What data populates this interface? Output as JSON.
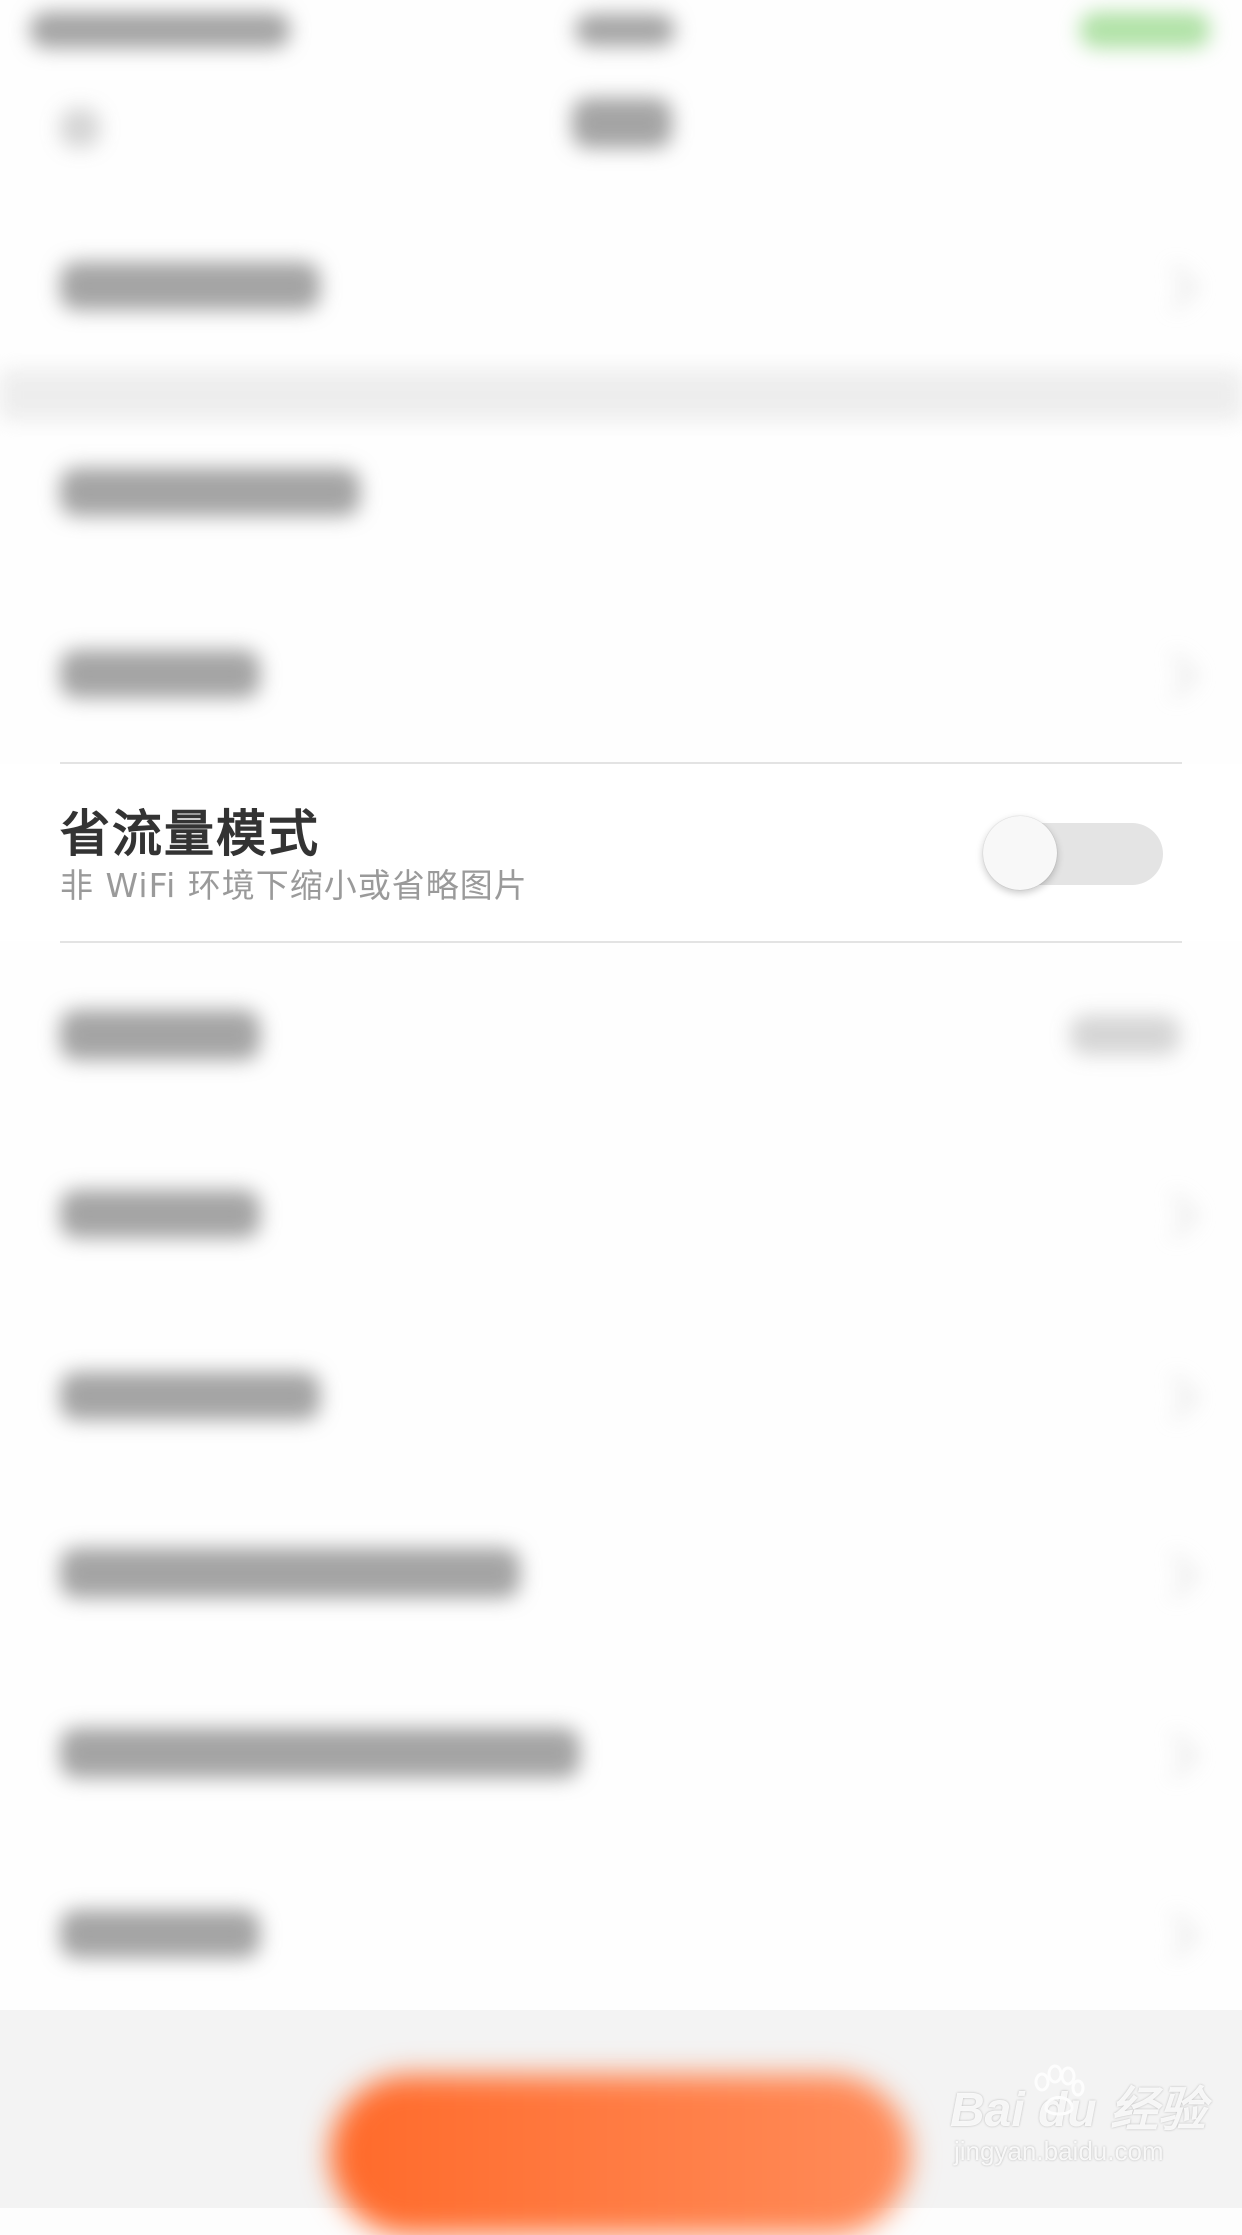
{
  "setting": {
    "title": "省流量模式",
    "subtitle": "非 WiFi 环境下缩小或省略图片",
    "toggle_on": false
  },
  "watermark": {
    "logo": "Bai du 经验",
    "url": "jingyan.baidu.com"
  },
  "colors": {
    "accent_orange": "#ff6a2a",
    "toggle_track_off": "#e4e4e4",
    "title_text": "#333333",
    "subtitle_text": "#9a9a9a"
  }
}
